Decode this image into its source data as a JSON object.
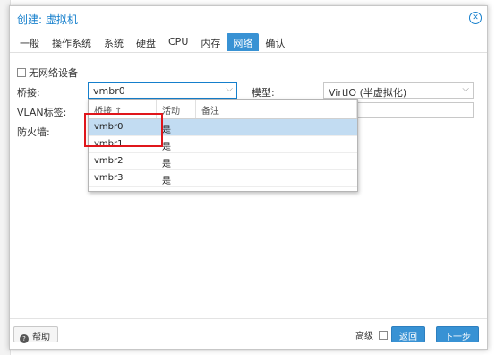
{
  "dialog": {
    "title": "创建: 虚拟机"
  },
  "tabs": [
    {
      "label": "一般",
      "active": false
    },
    {
      "label": "操作系统",
      "active": false
    },
    {
      "label": "系统",
      "active": false
    },
    {
      "label": "硬盘",
      "active": false
    },
    {
      "label": "CPU",
      "active": false
    },
    {
      "label": "内存",
      "active": false
    },
    {
      "label": "网络",
      "active": true
    },
    {
      "label": "确认",
      "active": false
    }
  ],
  "form": {
    "no_network_label": "无网络设备",
    "bridge_label": "桥接:",
    "bridge_value": "vmbr0",
    "vlan_label": "VLAN标签:",
    "firewall_label": "防火墙:",
    "model_label": "模型:",
    "model_value": "VirtIO (半虚拟化)"
  },
  "dropdown": {
    "headers": [
      "桥接 ↑",
      "活动",
      "备注"
    ],
    "rows": [
      {
        "name": "vmbr0",
        "active": "是",
        "note": "",
        "selected": true
      },
      {
        "name": "vmbr1",
        "active": "是",
        "note": "",
        "selected": false
      },
      {
        "name": "vmbr2",
        "active": "是",
        "note": "",
        "selected": false
      },
      {
        "name": "vmbr3",
        "active": "是",
        "note": "",
        "selected": false
      }
    ]
  },
  "footer": {
    "help_label": "帮助",
    "advanced_label": "高级",
    "back_label": "返回",
    "next_label": "下一步"
  },
  "colors": {
    "accent": "#3892d4",
    "title": "#157fcc",
    "selected_row": "#c2dcf2",
    "highlight": "#e0161b"
  }
}
